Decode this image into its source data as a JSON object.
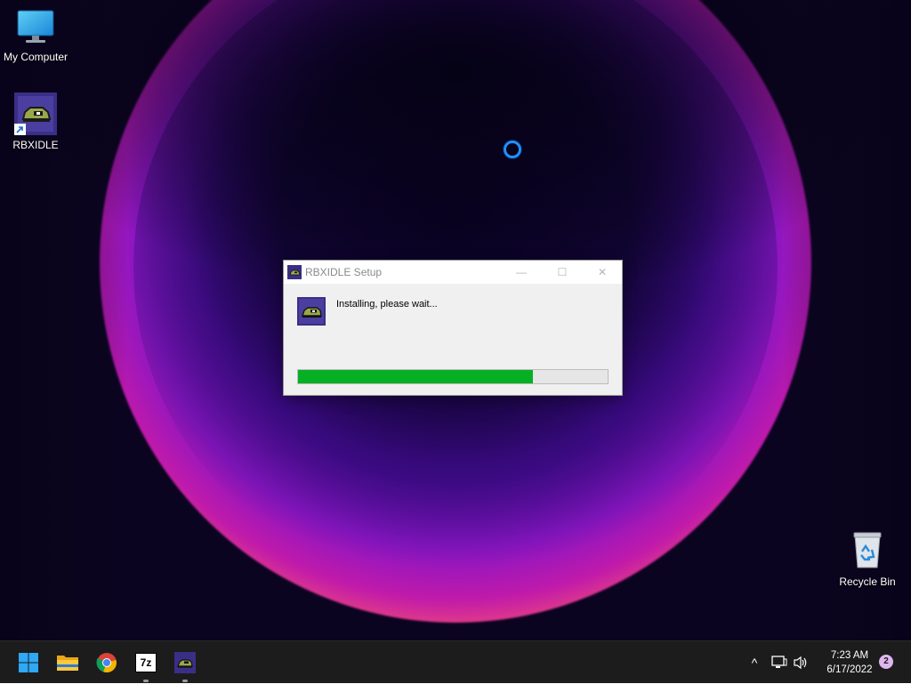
{
  "desktop": {
    "icons": [
      {
        "label": "My Computer",
        "icon": "monitor-icon"
      },
      {
        "label": "RBXIDLE",
        "icon": "rbxidle-app-icon",
        "shortcut": true
      },
      {
        "label": "Recycle Bin",
        "icon": "recycle-bin-icon"
      }
    ]
  },
  "setup_window": {
    "title": "RBXIDLE Setup",
    "status": "Installing, please wait...",
    "progress_fraction": 0.76,
    "buttons": {
      "minimize": "—",
      "maximize": "☐",
      "close": "✕"
    }
  },
  "taskbar": {
    "apps": [
      {
        "name": "start",
        "icon": "windows-logo-icon"
      },
      {
        "name": "file-explorer",
        "icon": "folder-icon"
      },
      {
        "name": "chrome",
        "icon": "chrome-icon"
      },
      {
        "name": "7zip",
        "icon": "7zip-icon",
        "label": "7z",
        "running": true
      },
      {
        "name": "rbxidle",
        "icon": "rbxidle-app-icon",
        "running": true
      }
    ],
    "tray": {
      "chevron": "^",
      "time": "7:23 AM",
      "date": "6/17/2022",
      "notifications": "2"
    }
  },
  "colors": {
    "progress_fill": "#06b025",
    "taskbar_bg": "#1c1c1c",
    "cursor_ring": "#1e90ff",
    "notif_badge": "#dfb5ef"
  }
}
